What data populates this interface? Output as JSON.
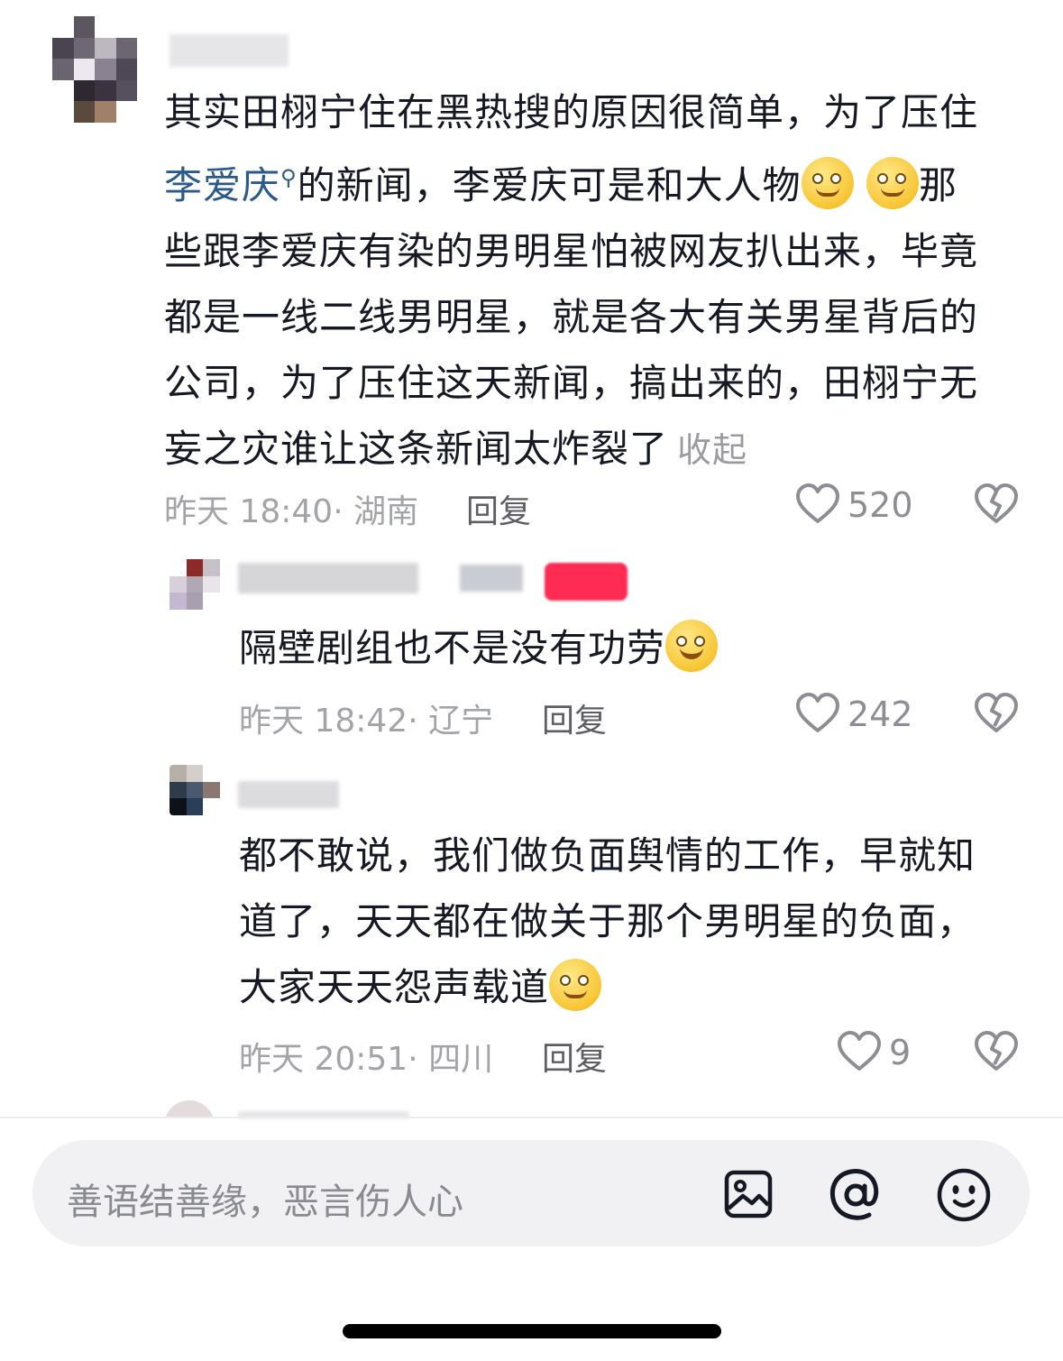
{
  "comments": [
    {
      "text_line1": "其实田栩宁住在黑热搜的原因很简单，为了压住",
      "mention": "李爱庆",
      "text_line2_rest": "的新闻，李爱庆可是和大人物",
      "text_line2_tail": "那",
      "text_line3": "些跟李爱庆有染的男明星怕被网友扒出来，毕竟",
      "text_line4": "都是一线二线男明星，就是各大有关男星背后的",
      "text_line5": "公司，为了压住这天新闻，搞出来的，田栩宁无",
      "text_line6": "妄之灾谁让这条新闻太炸裂了",
      "collapse_label": "收起",
      "meta": "昨天 18:40· 湖南",
      "reply_label": "回复",
      "likes": "520"
    },
    {
      "text_line1": "隔壁剧组也不是没有功劳",
      "meta": "昨天 18:42· 辽宁",
      "reply_label": "回复",
      "likes": "242"
    },
    {
      "text_line1": "都不敢说，我们做负面舆情的工作，早就知",
      "text_line2": "道了，天天都在做关于那个男明星的负面，",
      "text_line3": "大家天天怨声载道",
      "meta": "昨天 20:51· 四川",
      "reply_label": "回复",
      "likes": "9"
    }
  ],
  "input": {
    "placeholder": "善语结善缘，恶言伤人心"
  },
  "icons": {
    "like": "heart-icon",
    "dislike": "broken-heart-icon",
    "image": "image-icon",
    "mention": "at-icon",
    "emoji": "emoji-icon",
    "search": "search-icon"
  },
  "colors": {
    "mention": "#2b5a8a",
    "author_badge": "#fe2c55",
    "text": "#161823",
    "muted": "#a3a4a8"
  }
}
